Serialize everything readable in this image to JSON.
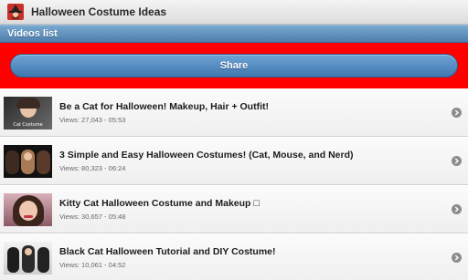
{
  "app": {
    "title": "Halloween Costume Ideas",
    "icon": "witch-logo-icon"
  },
  "section": {
    "title": "Videos list"
  },
  "share": {
    "label": "Share",
    "area_color": "#ff0000",
    "button_color": "#4f86bf"
  },
  "videos": [
    {
      "title": "Be a Cat for Halloween! Makeup, Hair + Outfit!",
      "meta": "Views: 27,043 - 05:53",
      "thumbnail_caption": "Cat Costume"
    },
    {
      "title": "3 Simple and Easy Halloween Costumes! (Cat, Mouse, and Nerd)",
      "meta": "Views: 80,323 - 06:24",
      "thumbnail_caption": ""
    },
    {
      "title": "Kitty Cat Halloween Costume and Makeup □",
      "meta": "Views: 30,657 - 05:48",
      "thumbnail_caption": ""
    },
    {
      "title": "Black Cat Halloween Tutorial and DIY Costume!",
      "meta": "Views: 10,061 - 04:52",
      "thumbnail_caption": ""
    }
  ]
}
